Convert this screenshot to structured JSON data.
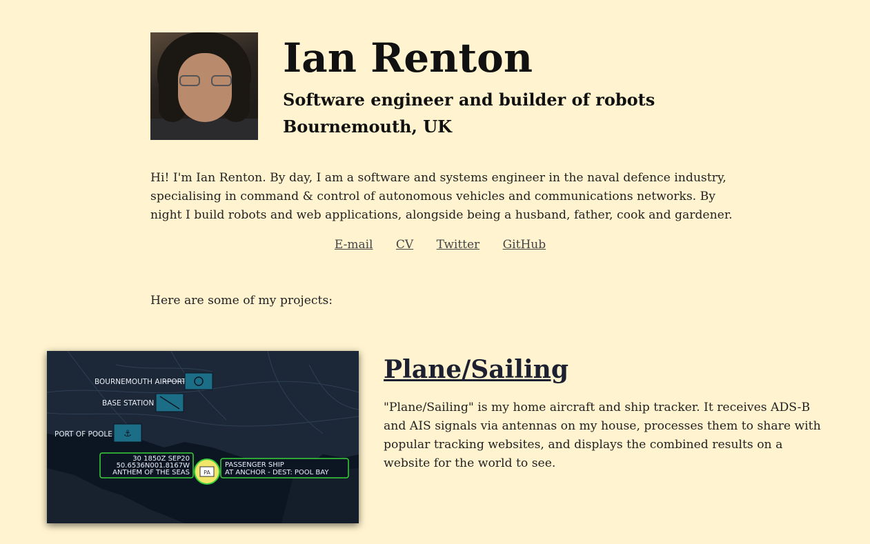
{
  "profile": {
    "name": "Ian Renton",
    "tagline": "Software engineer and builder of robots",
    "location": "Bournemouth, UK",
    "intro": "Hi! I'm Ian Renton. By day, I am a software and systems engineer in the naval defence industry, specialising in command & control of autonomous vehicles and communications networks. By night I build robots and web applications, alongside being a husband, father, cook and gardener."
  },
  "links": {
    "email": "E-mail",
    "cv": "CV",
    "twitter": "Twitter",
    "github": "GitHub"
  },
  "projects_heading": "Here are some of my projects:",
  "project": {
    "title": "Plane/Sailing",
    "description": "\"Plane/Sailing\" is my home aircraft and ship tracker. It receives ADS-B and AIS signals via antennas on my house, processes them to share with popular tracking websites, and displays the combined results on a website for the world to see.",
    "map": {
      "airport_label": "BOURNEMOUTH AIRPORT",
      "base_label": "BASE STATION",
      "port_label": "PORT OF POOLE",
      "ship_time": "30 1850Z SEP20",
      "ship_position": "50.6536N001.8167W",
      "ship_name": "ANTHEM OF THE SEAS",
      "ship_type": "PASSENGER SHIP",
      "ship_status": "AT ANCHOR - DEST: POOL BAY",
      "ship_symbol_label": "PA"
    }
  },
  "colors": {
    "background": "#fff4cf",
    "text": "#222222",
    "link": "#444444",
    "map_sea": "#0e1a26",
    "map_land": "#1f2c3b",
    "marker_fill": "#1c6e86",
    "ship_outline": "#3ad13a",
    "ship_symbol": "#f2e66a"
  }
}
